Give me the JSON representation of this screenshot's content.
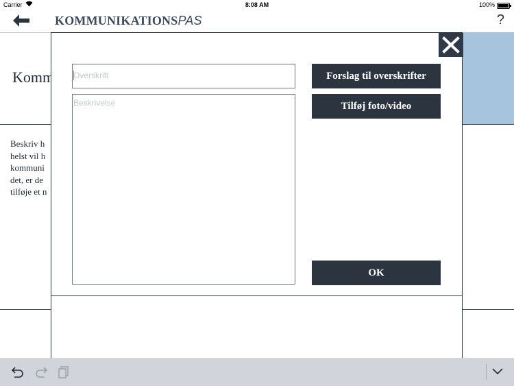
{
  "status_bar": {
    "carrier": "Carrier",
    "time": "8:08 AM",
    "battery": "100%"
  },
  "nav": {
    "title_bold": "KOMMUNIKATIONS",
    "title_italic": "PAS",
    "help": "?"
  },
  "background": {
    "title_fragment": "Komm",
    "text_lines": [
      "Beskriv h",
      "helst vil h",
      "kommuni",
      "det, er de",
      "tilføje et n"
    ],
    "accent_color": "#a7c4de"
  },
  "modal": {
    "headline_placeholder": "Overskrift",
    "description_placeholder": "Beskrivelse",
    "suggest_button": "Forslag til overskrifter",
    "media_button": "Tilføj foto/video",
    "ok_button": "OK",
    "button_color": "#2c3440"
  },
  "toolbar": {
    "icons": [
      "undo-icon",
      "redo-icon",
      "paste-icon",
      "keyboard-dismiss-icon"
    ]
  }
}
